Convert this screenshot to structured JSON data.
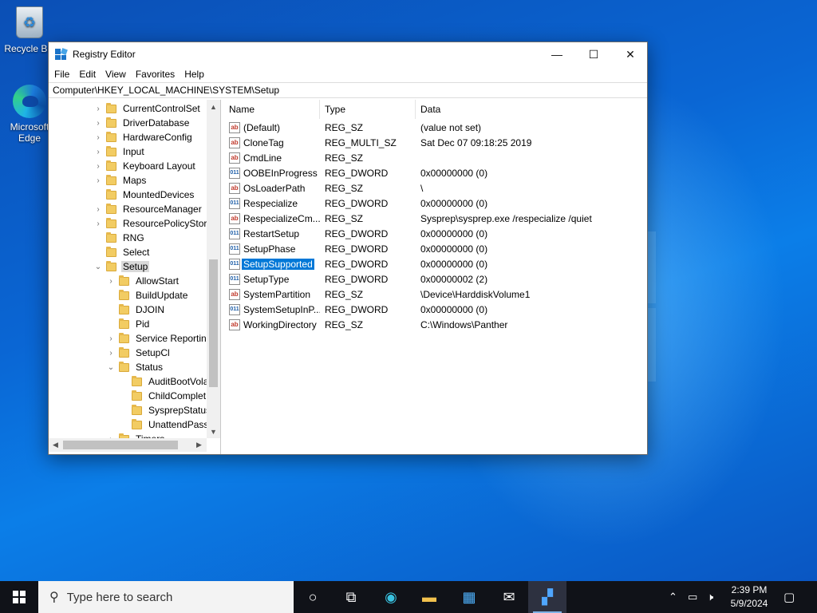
{
  "desktop": {
    "icons": [
      {
        "label": "Recycle Bin",
        "icon": "recycle-bin-icon"
      },
      {
        "label": "Microsoft Edge",
        "icon": "edge-icon"
      }
    ]
  },
  "window": {
    "title": "Registry Editor",
    "controls": {
      "minimize": "—",
      "maximize": "☐",
      "close": "✕"
    },
    "menu": [
      "File",
      "Edit",
      "View",
      "Favorites",
      "Help"
    ],
    "address": "Computer\\HKEY_LOCAL_MACHINE\\SYSTEM\\Setup"
  },
  "tree": {
    "nodes": [
      {
        "label": "CurrentControlSet",
        "level": 0,
        "expander": "›"
      },
      {
        "label": "DriverDatabase",
        "level": 0,
        "expander": "›"
      },
      {
        "label": "HardwareConfig",
        "level": 0,
        "expander": "›"
      },
      {
        "label": "Input",
        "level": 0,
        "expander": "›"
      },
      {
        "label": "Keyboard Layout",
        "level": 0,
        "expander": "›"
      },
      {
        "label": "Maps",
        "level": 0,
        "expander": "›"
      },
      {
        "label": "MountedDevices",
        "level": 0,
        "expander": ""
      },
      {
        "label": "ResourceManager",
        "level": 0,
        "expander": "›"
      },
      {
        "label": "ResourcePolicyStore",
        "level": 0,
        "expander": "›"
      },
      {
        "label": "RNG",
        "level": 0,
        "expander": ""
      },
      {
        "label": "Select",
        "level": 0,
        "expander": ""
      },
      {
        "label": "Setup",
        "level": 0,
        "expander": "⌄",
        "selected": true
      },
      {
        "label": "AllowStart",
        "level": 1,
        "expander": "›"
      },
      {
        "label": "BuildUpdate",
        "level": 1,
        "expander": ""
      },
      {
        "label": "DJOIN",
        "level": 1,
        "expander": ""
      },
      {
        "label": "Pid",
        "level": 1,
        "expander": ""
      },
      {
        "label": "Service Reporting",
        "level": 1,
        "expander": "›"
      },
      {
        "label": "SetupCl",
        "level": 1,
        "expander": "›"
      },
      {
        "label": "Status",
        "level": 1,
        "expander": "⌄"
      },
      {
        "label": "AuditBootVola",
        "level": 2,
        "expander": ""
      },
      {
        "label": "ChildComplet",
        "level": 2,
        "expander": ""
      },
      {
        "label": "SysprepStatus",
        "level": 2,
        "expander": ""
      },
      {
        "label": "UnattendPasse",
        "level": 2,
        "expander": ""
      },
      {
        "label": "Timers",
        "level": 1,
        "expander": "›"
      }
    ]
  },
  "list": {
    "columns": [
      "Name",
      "Type",
      "Data"
    ],
    "rows": [
      {
        "name": "(Default)",
        "type": "REG_SZ",
        "data": "(value not set)",
        "kind": "sz"
      },
      {
        "name": "CloneTag",
        "type": "REG_MULTI_SZ",
        "data": "Sat Dec 07 09:18:25 2019",
        "kind": "sz"
      },
      {
        "name": "CmdLine",
        "type": "REG_SZ",
        "data": "",
        "kind": "sz"
      },
      {
        "name": "OOBEInProgress",
        "type": "REG_DWORD",
        "data": "0x00000000 (0)",
        "kind": "bin"
      },
      {
        "name": "OsLoaderPath",
        "type": "REG_SZ",
        "data": "\\",
        "kind": "sz"
      },
      {
        "name": "Respecialize",
        "type": "REG_DWORD",
        "data": "0x00000000 (0)",
        "kind": "bin"
      },
      {
        "name": "RespecializeCm...",
        "type": "REG_SZ",
        "data": "Sysprep\\sysprep.exe /respecialize /quiet",
        "kind": "sz"
      },
      {
        "name": "RestartSetup",
        "type": "REG_DWORD",
        "data": "0x00000000 (0)",
        "kind": "bin"
      },
      {
        "name": "SetupPhase",
        "type": "REG_DWORD",
        "data": "0x00000000 (0)",
        "kind": "bin"
      },
      {
        "name": "SetupSupported",
        "type": "REG_DWORD",
        "data": "0x00000000 (0)",
        "kind": "bin",
        "selected": true
      },
      {
        "name": "SetupType",
        "type": "REG_DWORD",
        "data": "0x00000002 (2)",
        "kind": "bin"
      },
      {
        "name": "SystemPartition",
        "type": "REG_SZ",
        "data": "\\Device\\HarddiskVolume1",
        "kind": "sz"
      },
      {
        "name": "SystemSetupInP...",
        "type": "REG_DWORD",
        "data": "0x00000000 (0)",
        "kind": "bin"
      },
      {
        "name": "WorkingDirectory",
        "type": "REG_SZ",
        "data": "C:\\Windows\\Panther",
        "kind": "sz"
      }
    ]
  },
  "taskbar": {
    "search_placeholder": "Type here to search",
    "time": "2:39 PM",
    "date": "5/9/2024"
  }
}
